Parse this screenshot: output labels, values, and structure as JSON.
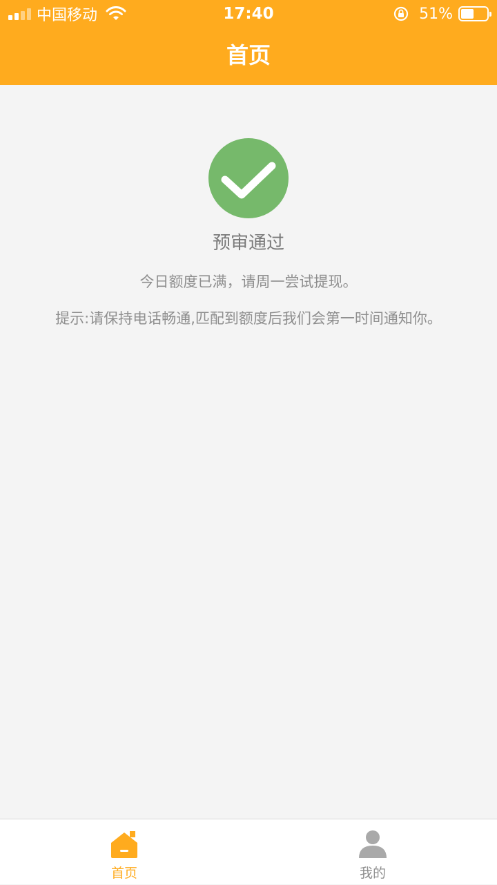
{
  "status_bar": {
    "carrier": "中国移动",
    "time": "17:40",
    "battery_percent": "51%",
    "battery_level": 0.51,
    "icons": [
      "signal-icon",
      "wifi-icon",
      "rotation-lock-icon",
      "battery-icon"
    ]
  },
  "header": {
    "title": "首页",
    "background_color": "#ffab1e"
  },
  "result": {
    "icon": "check-circle-icon",
    "icon_color": "#76b96b",
    "title": "预审通过",
    "message": "今日额度已满，请周一尝试提现。",
    "hint": "提示:请保持电话畅通,匹配到额度后我们会第一时间通知你。"
  },
  "tabbar": {
    "tabs": [
      {
        "label": "首页",
        "icon": "home-icon",
        "active": true
      },
      {
        "label": "我的",
        "icon": "person-icon",
        "active": false
      }
    ],
    "active_color": "#ffab1e",
    "inactive_color": "#8e8e8e"
  }
}
